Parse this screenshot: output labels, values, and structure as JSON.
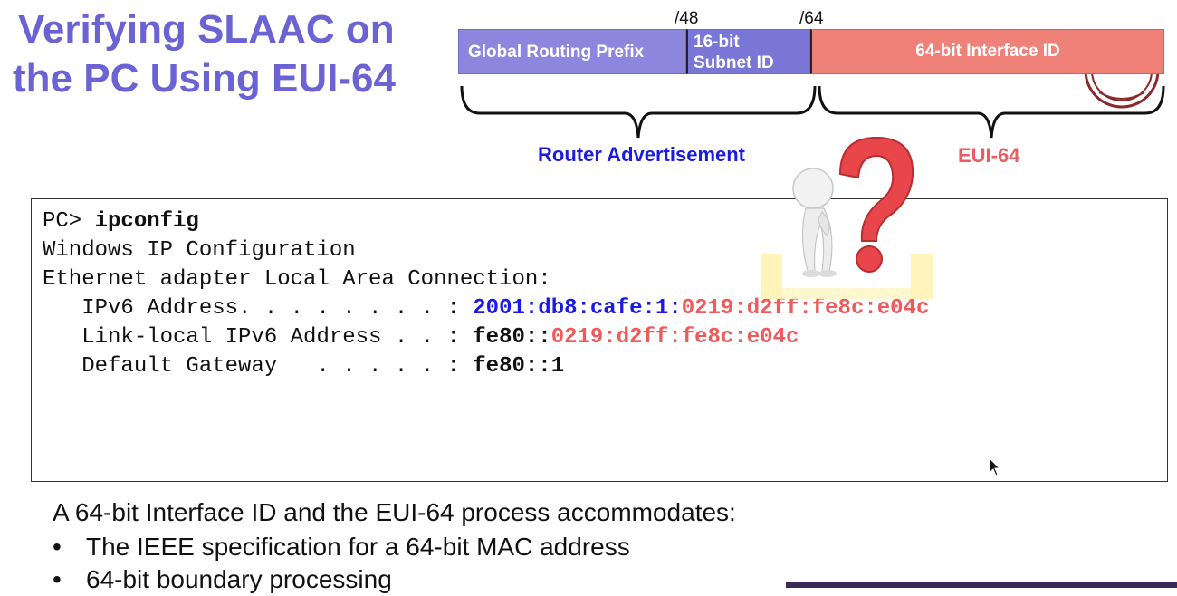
{
  "slide": {
    "title_line1": "Verifying SLAAC on",
    "title_line2": "the PC Using EUI-64"
  },
  "address_diagram": {
    "mark_48": "/48",
    "mark_64": "/64",
    "prefix_label": "Global Routing Prefix",
    "subnet_label_1": "16-bit",
    "subnet_label_2": "Subnet ID",
    "iid_label": "64-bit Interface ID",
    "ra_label": "Router Advertisement",
    "eui_label": "EUI-64",
    "colors": {
      "prefix": "#8c87dd",
      "subnet": "#7a76d6",
      "iid": "#f08178",
      "ra": "#1c1ce0",
      "eui": "#ef5a60"
    }
  },
  "terminal": {
    "prompt": "PC> ",
    "command": "ipconfig",
    "line2": "Windows IP Configuration",
    "line3": "Ethernet adapter Local Area Connection:",
    "ipv6_label": "   IPv6 Address. . . . . . . . : ",
    "ipv6_prefix": "2001:db8:cafe:1:",
    "ipv6_iid": "0219:d2ff:fe8c:e04c",
    "ll_label": "   Link-local IPv6 Address . . : ",
    "ll_prefix": "fe80::",
    "ll_iid": "0219:d2ff:fe8c:e04c",
    "gw_label": "   Default Gateway   . . . . . : ",
    "gw_value": "fe80::1"
  },
  "notes": {
    "intro": "A 64-bit Interface ID and the EUI-64 process accommodates:",
    "bullet_glyph": "•",
    "items": [
      "The IEEE specification for a 64-bit MAC address",
      "64-bit boundary processing"
    ]
  },
  "icons": [
    "thinking-figure-icon",
    "question-mark-icon",
    "mouse-cursor-icon",
    "university-seal-icon"
  ]
}
